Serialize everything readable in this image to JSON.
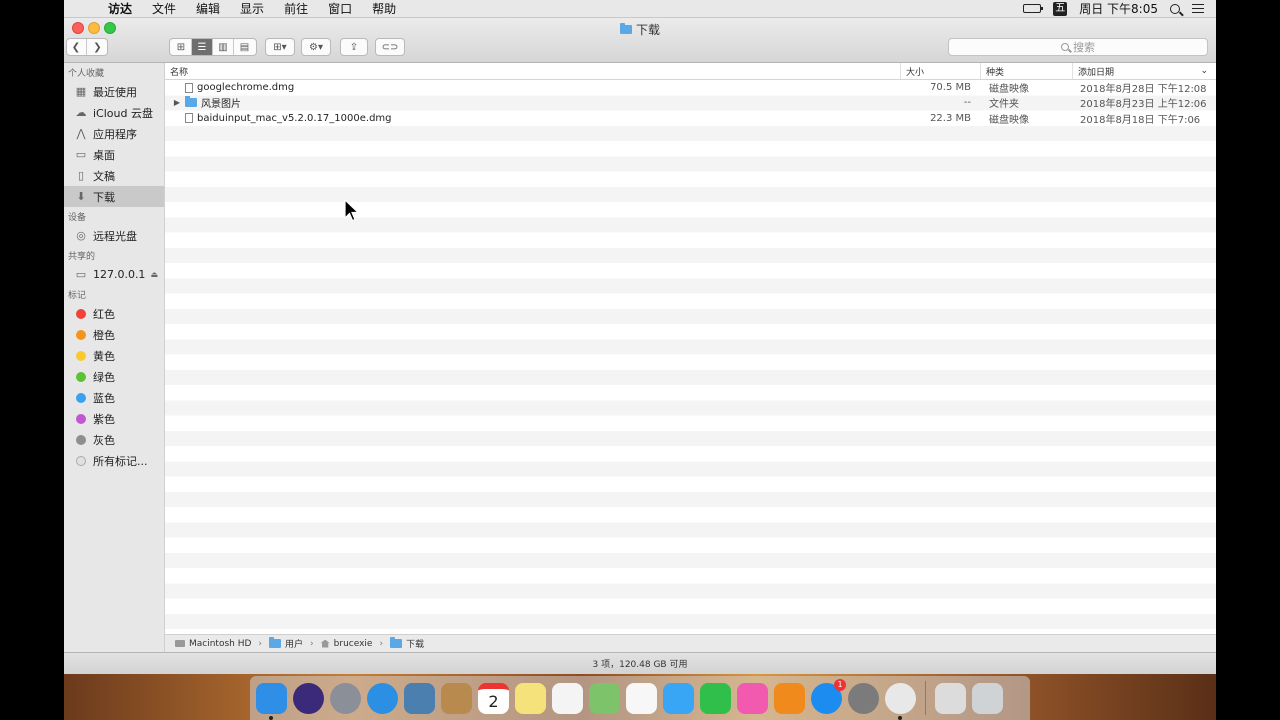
{
  "menubar": {
    "apple": "",
    "items": [
      "访达",
      "文件",
      "编辑",
      "显示",
      "前往",
      "窗口",
      "帮助"
    ],
    "ime": "五",
    "clock": "周日 下午8:05"
  },
  "window": {
    "title": "下载",
    "search_placeholder": "搜索"
  },
  "sidebar": {
    "sections": [
      {
        "header": "个人收藏",
        "items": [
          {
            "label": "最近使用",
            "icon": "recents-icon"
          },
          {
            "label": "iCloud 云盘",
            "icon": "icloud-icon"
          },
          {
            "label": "应用程序",
            "icon": "applications-icon"
          },
          {
            "label": "桌面",
            "icon": "desktop-icon"
          },
          {
            "label": "文稿",
            "icon": "documents-icon"
          },
          {
            "label": "下载",
            "icon": "downloads-icon",
            "selected": true
          }
        ]
      },
      {
        "header": "设备",
        "items": [
          {
            "label": "远程光盘",
            "icon": "disc-icon"
          }
        ]
      },
      {
        "header": "共享的",
        "items": [
          {
            "label": "127.0.0.1",
            "icon": "display-icon"
          }
        ]
      },
      {
        "header": "标记",
        "items": [
          {
            "label": "红色",
            "color": "#f0443a"
          },
          {
            "label": "橙色",
            "color": "#f6931d"
          },
          {
            "label": "黄色",
            "color": "#f9c92f"
          },
          {
            "label": "绿色",
            "color": "#5bc236"
          },
          {
            "label": "蓝色",
            "color": "#3aa1f0"
          },
          {
            "label": "紫色",
            "color": "#c058d0"
          },
          {
            "label": "灰色",
            "color": "#8e8e8e"
          },
          {
            "label": "所有标记...",
            "color": "#e0e0e0"
          }
        ]
      }
    ]
  },
  "columns": {
    "name": "名称",
    "size": "大小",
    "kind": "种类",
    "date": "添加日期"
  },
  "files": [
    {
      "name": "googlechrome.dmg",
      "size": "70.5 MB",
      "kind": "磁盘映像",
      "date": "2018年8月28日 下午12:08",
      "type": "doc"
    },
    {
      "name": "风景图片",
      "size": "--",
      "kind": "文件夹",
      "date": "2018年8月23日 上午12:06",
      "type": "folder"
    },
    {
      "name": "baiduinput_mac_v5.2.0.17_1000e.dmg",
      "size": "22.3 MB",
      "kind": "磁盘映像",
      "date": "2018年8月18日 下午7:06",
      "type": "doc"
    }
  ],
  "pathbar": [
    "Macintosh HD",
    "用户",
    "brucexie",
    "下载"
  ],
  "status": "3 项，120.48 GB 可用",
  "dock": {
    "calendar_day": "2",
    "appstore_badge": "1",
    "apps": [
      {
        "name": "finder",
        "color": "#2f8ee6"
      },
      {
        "name": "siri",
        "color": "#3b2a7a"
      },
      {
        "name": "launchpad",
        "color": "#8a8f98"
      },
      {
        "name": "safari",
        "color": "#2b8fe3"
      },
      {
        "name": "preview",
        "color": "#4a7fb0"
      },
      {
        "name": "contacts",
        "color": "#b98a4e"
      },
      {
        "name": "calendar",
        "color": "#ffffff"
      },
      {
        "name": "notes",
        "color": "#f6e27a"
      },
      {
        "name": "reminders",
        "color": "#f4f4f4"
      },
      {
        "name": "maps",
        "color": "#7cc36a"
      },
      {
        "name": "photos",
        "color": "#f7f7f7"
      },
      {
        "name": "messages",
        "color": "#38a6f5"
      },
      {
        "name": "facetime",
        "color": "#2fbf4a"
      },
      {
        "name": "itunes",
        "color": "#f25ab0"
      },
      {
        "name": "ibooks",
        "color": "#f08a1c"
      },
      {
        "name": "appstore",
        "color": "#1d8cf0"
      },
      {
        "name": "system-preferences",
        "color": "#7b7b7b"
      },
      {
        "name": "chrome",
        "color": "#e8e8e8"
      },
      {
        "name": "documents-stack",
        "color": "#dcdcdc"
      },
      {
        "name": "trash",
        "color": "#cfd3d6"
      }
    ]
  }
}
